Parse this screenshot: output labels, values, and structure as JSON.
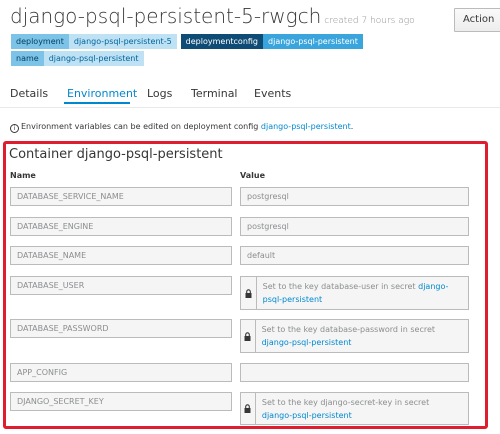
{
  "header": {
    "title": "django-psql-persistent-5-rwgch",
    "created": "created 7 hours ago",
    "actions_label": "Action"
  },
  "labels": [
    {
      "key": "deployment",
      "value": "django-psql-persistent-5",
      "style": "light"
    },
    {
      "key": "deploymentconfig",
      "value": "django-psql-persistent",
      "style": "dark"
    },
    {
      "key": "name",
      "value": "django-psql-persistent",
      "style": "light"
    }
  ],
  "tabs": [
    {
      "label": "Details",
      "active": false
    },
    {
      "label": "Environment",
      "active": true
    },
    {
      "label": "Logs",
      "active": false
    },
    {
      "label": "Terminal",
      "active": false
    },
    {
      "label": "Events",
      "active": false
    }
  ],
  "notice": {
    "text": "Environment variables can be edited on deployment config ",
    "link": "django-psql-persistent",
    "suffix": "."
  },
  "container": {
    "title": "Container django-psql-persistent",
    "name_header": "Name",
    "value_header": "Value",
    "env": [
      {
        "name": "DATABASE_SERVICE_NAME",
        "value": "postgresql"
      },
      {
        "name": "DATABASE_ENGINE",
        "value": "postgresql"
      },
      {
        "name": "DATABASE_NAME",
        "value": "default"
      },
      {
        "name": "DATABASE_USER",
        "secret_text": "Set to the key database-user in secret ",
        "secret_link": "django-psql-persistent"
      },
      {
        "name": "DATABASE_PASSWORD",
        "secret_text": "Set to the key database-password in secret ",
        "secret_link": "django-psql-persistent"
      },
      {
        "name": "APP_CONFIG",
        "value": ""
      },
      {
        "name": "DJANGO_SECRET_KEY",
        "secret_text": "Set to the key django-secret-key in secret ",
        "secret_link": "django-psql-persistent"
      }
    ]
  },
  "colors": {
    "accent": "#0088ce",
    "highlight_border": "#e01d2e"
  }
}
